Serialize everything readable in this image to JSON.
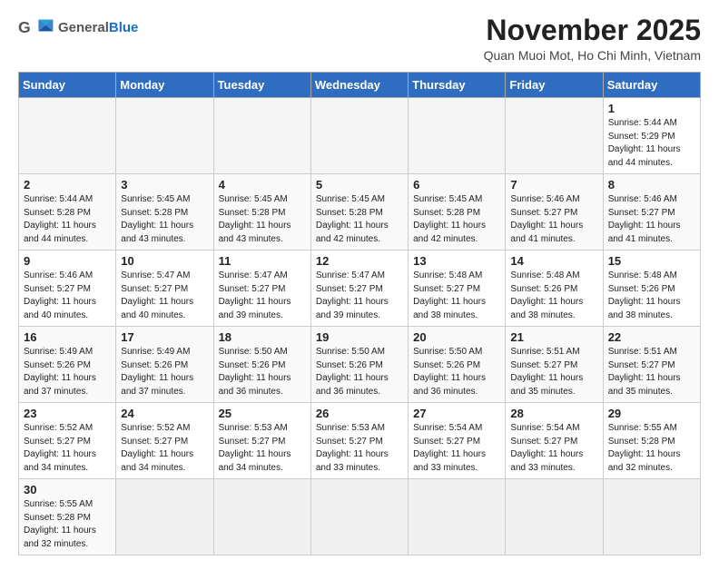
{
  "header": {
    "logo_general": "General",
    "logo_blue": "Blue",
    "month_title": "November 2025",
    "location": "Quan Muoi Mot, Ho Chi Minh, Vietnam"
  },
  "columns": [
    "Sunday",
    "Monday",
    "Tuesday",
    "Wednesday",
    "Thursday",
    "Friday",
    "Saturday"
  ],
  "weeks": [
    [
      {
        "day": "",
        "info": ""
      },
      {
        "day": "",
        "info": ""
      },
      {
        "day": "",
        "info": ""
      },
      {
        "day": "",
        "info": ""
      },
      {
        "day": "",
        "info": ""
      },
      {
        "day": "",
        "info": ""
      },
      {
        "day": "1",
        "info": "Sunrise: 5:44 AM\nSunset: 5:29 PM\nDaylight: 11 hours\nand 44 minutes."
      }
    ],
    [
      {
        "day": "2",
        "info": "Sunrise: 5:44 AM\nSunset: 5:28 PM\nDaylight: 11 hours\nand 44 minutes."
      },
      {
        "day": "3",
        "info": "Sunrise: 5:45 AM\nSunset: 5:28 PM\nDaylight: 11 hours\nand 43 minutes."
      },
      {
        "day": "4",
        "info": "Sunrise: 5:45 AM\nSunset: 5:28 PM\nDaylight: 11 hours\nand 43 minutes."
      },
      {
        "day": "5",
        "info": "Sunrise: 5:45 AM\nSunset: 5:28 PM\nDaylight: 11 hours\nand 42 minutes."
      },
      {
        "day": "6",
        "info": "Sunrise: 5:45 AM\nSunset: 5:28 PM\nDaylight: 11 hours\nand 42 minutes."
      },
      {
        "day": "7",
        "info": "Sunrise: 5:46 AM\nSunset: 5:27 PM\nDaylight: 11 hours\nand 41 minutes."
      },
      {
        "day": "8",
        "info": "Sunrise: 5:46 AM\nSunset: 5:27 PM\nDaylight: 11 hours\nand 41 minutes."
      }
    ],
    [
      {
        "day": "9",
        "info": "Sunrise: 5:46 AM\nSunset: 5:27 PM\nDaylight: 11 hours\nand 40 minutes."
      },
      {
        "day": "10",
        "info": "Sunrise: 5:47 AM\nSunset: 5:27 PM\nDaylight: 11 hours\nand 40 minutes."
      },
      {
        "day": "11",
        "info": "Sunrise: 5:47 AM\nSunset: 5:27 PM\nDaylight: 11 hours\nand 39 minutes."
      },
      {
        "day": "12",
        "info": "Sunrise: 5:47 AM\nSunset: 5:27 PM\nDaylight: 11 hours\nand 39 minutes."
      },
      {
        "day": "13",
        "info": "Sunrise: 5:48 AM\nSunset: 5:27 PM\nDaylight: 11 hours\nand 38 minutes."
      },
      {
        "day": "14",
        "info": "Sunrise: 5:48 AM\nSunset: 5:26 PM\nDaylight: 11 hours\nand 38 minutes."
      },
      {
        "day": "15",
        "info": "Sunrise: 5:48 AM\nSunset: 5:26 PM\nDaylight: 11 hours\nand 38 minutes."
      }
    ],
    [
      {
        "day": "16",
        "info": "Sunrise: 5:49 AM\nSunset: 5:26 PM\nDaylight: 11 hours\nand 37 minutes."
      },
      {
        "day": "17",
        "info": "Sunrise: 5:49 AM\nSunset: 5:26 PM\nDaylight: 11 hours\nand 37 minutes."
      },
      {
        "day": "18",
        "info": "Sunrise: 5:50 AM\nSunset: 5:26 PM\nDaylight: 11 hours\nand 36 minutes."
      },
      {
        "day": "19",
        "info": "Sunrise: 5:50 AM\nSunset: 5:26 PM\nDaylight: 11 hours\nand 36 minutes."
      },
      {
        "day": "20",
        "info": "Sunrise: 5:50 AM\nSunset: 5:26 PM\nDaylight: 11 hours\nand 36 minutes."
      },
      {
        "day": "21",
        "info": "Sunrise: 5:51 AM\nSunset: 5:27 PM\nDaylight: 11 hours\nand 35 minutes."
      },
      {
        "day": "22",
        "info": "Sunrise: 5:51 AM\nSunset: 5:27 PM\nDaylight: 11 hours\nand 35 minutes."
      }
    ],
    [
      {
        "day": "23",
        "info": "Sunrise: 5:52 AM\nSunset: 5:27 PM\nDaylight: 11 hours\nand 34 minutes."
      },
      {
        "day": "24",
        "info": "Sunrise: 5:52 AM\nSunset: 5:27 PM\nDaylight: 11 hours\nand 34 minutes."
      },
      {
        "day": "25",
        "info": "Sunrise: 5:53 AM\nSunset: 5:27 PM\nDaylight: 11 hours\nand 34 minutes."
      },
      {
        "day": "26",
        "info": "Sunrise: 5:53 AM\nSunset: 5:27 PM\nDaylight: 11 hours\nand 33 minutes."
      },
      {
        "day": "27",
        "info": "Sunrise: 5:54 AM\nSunset: 5:27 PM\nDaylight: 11 hours\nand 33 minutes."
      },
      {
        "day": "28",
        "info": "Sunrise: 5:54 AM\nSunset: 5:27 PM\nDaylight: 11 hours\nand 33 minutes."
      },
      {
        "day": "29",
        "info": "Sunrise: 5:55 AM\nSunset: 5:28 PM\nDaylight: 11 hours\nand 32 minutes."
      }
    ],
    [
      {
        "day": "30",
        "info": "Sunrise: 5:55 AM\nSunset: 5:28 PM\nDaylight: 11 hours\nand 32 minutes."
      },
      {
        "day": "",
        "info": ""
      },
      {
        "day": "",
        "info": ""
      },
      {
        "day": "",
        "info": ""
      },
      {
        "day": "",
        "info": ""
      },
      {
        "day": "",
        "info": ""
      },
      {
        "day": "",
        "info": ""
      }
    ]
  ]
}
